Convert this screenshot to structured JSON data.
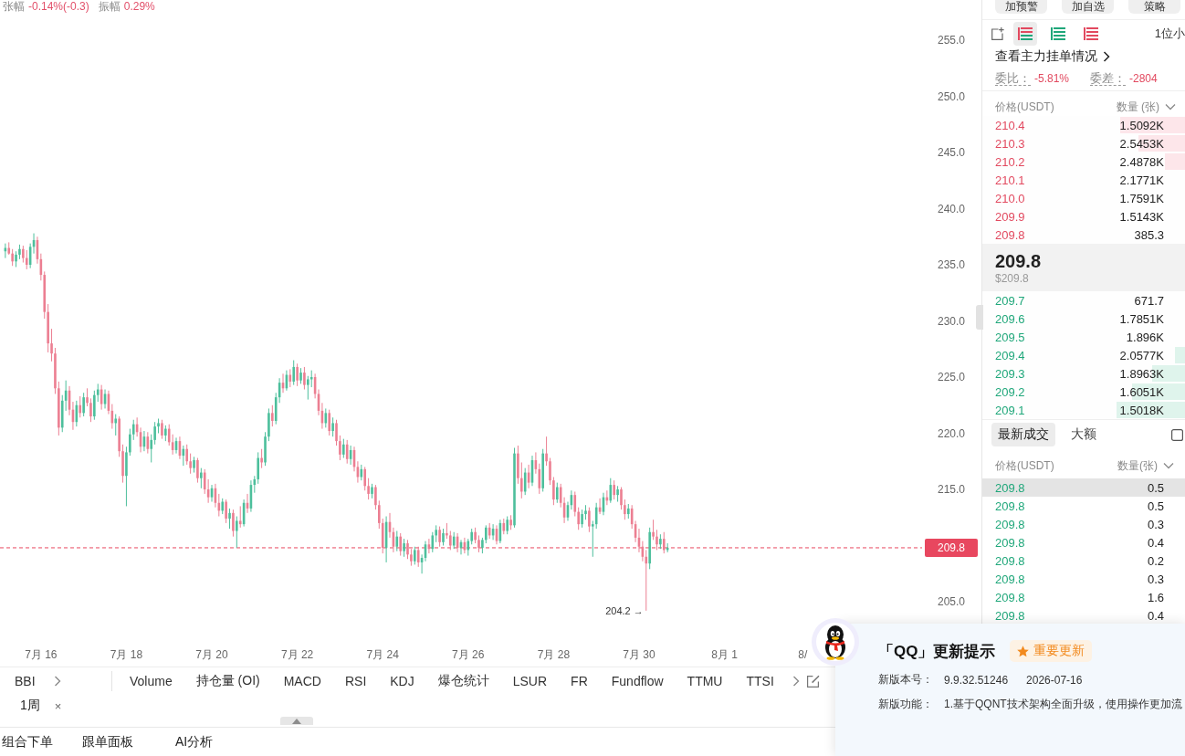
{
  "header": {
    "change_label": "张幅",
    "change_value": "-0.14%(-0.3)",
    "amplitude_label": "振幅",
    "amplitude_value": "0.29%"
  },
  "chart": {
    "chart_data": [
      {
        "type": "candlestick",
        "categories": [
          null,
          null,
          null,
          null,
          null,
          null,
          null,
          null,
          null,
          null,
          null,
          "7月 16",
          null,
          null,
          null,
          null,
          null,
          null,
          null,
          null,
          null,
          null,
          null,
          null,
          null,
          null,
          null,
          null,
          null,
          null,
          null,
          null,
          null,
          null,
          null,
          "7月 18",
          null,
          null,
          null,
          null,
          null,
          null,
          null,
          null,
          null,
          null,
          null,
          null,
          null,
          null,
          null,
          null,
          null,
          null,
          null,
          null,
          null,
          null,
          null,
          "7月 20",
          null,
          null,
          null,
          null,
          null,
          null,
          null,
          null,
          null,
          null,
          null,
          null,
          null,
          null,
          null,
          null,
          null,
          null,
          null,
          null,
          null,
          null,
          null,
          "7月 22",
          null,
          null,
          null,
          null,
          null,
          null,
          null,
          null,
          null,
          null,
          null,
          null,
          null,
          null,
          null,
          null,
          null,
          null,
          null,
          null,
          null,
          null,
          null,
          "7月 24",
          null,
          null,
          null,
          null,
          null,
          null,
          null,
          null,
          null,
          null,
          null,
          null,
          null,
          null,
          null,
          null,
          null,
          null,
          null,
          null,
          null,
          null,
          null,
          "7月 26",
          null,
          null,
          null,
          null,
          null,
          null,
          null,
          null,
          null,
          null,
          null,
          null,
          null,
          null,
          null,
          null,
          null,
          null,
          null,
          null,
          null,
          null,
          null,
          "7月 28",
          null,
          null,
          null,
          null,
          null,
          null,
          null,
          null,
          null,
          null,
          null,
          null,
          null,
          null,
          null,
          null,
          null,
          null,
          null,
          null,
          null,
          null,
          null,
          "7月 30",
          null,
          null,
          null,
          null,
          null,
          null,
          null,
          null,
          null,
          null,
          null,
          null,
          null,
          null,
          null,
          null,
          null,
          null,
          null,
          null,
          null,
          null,
          null,
          "8月 1",
          null,
          null,
          null,
          null,
          null,
          null,
          null,
          null,
          null,
          null,
          null,
          null,
          null,
          null,
          null,
          null,
          null,
          null,
          null,
          null,
          null,
          "8/",
          null,
          null,
          null,
          null,
          null,
          null,
          null,
          null,
          null,
          null,
          null,
          null,
          null,
          null,
          null,
          null,
          null,
          null,
          null,
          null,
          null,
          null,
          null,
          null,
          null,
          null,
          null,
          null,
          null,
          null,
          null,
          null,
          null
        ],
        "ylim": [
          205,
          255
        ],
        "yticks": [
          {
            "value": 205,
            "label": "205.0"
          },
          {
            "value": 215,
            "label": "215.0"
          },
          {
            "value": 220,
            "label": "220.0"
          },
          {
            "value": 225,
            "label": "225.0"
          },
          {
            "value": 230,
            "label": "230.0"
          },
          {
            "value": 235,
            "label": "235.0"
          },
          {
            "value": 240,
            "label": "240.0"
          },
          {
            "value": 245,
            "label": "245.0"
          },
          {
            "value": 250,
            "label": "250.0"
          },
          {
            "value": 255,
            "label": "255.0"
          }
        ],
        "ref_lines": [
          {
            "axis": "y",
            "value": 209.8,
            "label": "209.8",
            "color": "#e8475f",
            "line_style": "dashed"
          }
        ],
        "annotations": [
          "204.2 →"
        ],
        "ohlc": [
          null,
          [
            236.2,
            236.9,
            235.6,
            236.5
          ],
          [
            236.5,
            237.0,
            235.9,
            236.0
          ],
          [
            236.0,
            236.4,
            234.9,
            235.3
          ],
          [
            235.3,
            236.2,
            234.8,
            235.9
          ],
          [
            235.9,
            236.8,
            235.5,
            236.4
          ],
          [
            236.4,
            236.7,
            235.2,
            235.6
          ],
          [
            235.6,
            236.3,
            234.6,
            235.0
          ],
          [
            235.0,
            236.9,
            234.7,
            236.6
          ],
          [
            236.6,
            237.8,
            236.0,
            237.2
          ],
          [
            237.2,
            237.5,
            235.1,
            235.5
          ],
          [
            235.5,
            236.0,
            233.6,
            234.1
          ],
          [
            234.1,
            234.4,
            230.2,
            230.8
          ],
          [
            230.8,
            231.5,
            227.2,
            228.0
          ],
          [
            228.0,
            229.3,
            226.4,
            227.1
          ],
          [
            227.1,
            227.6,
            223.5,
            224.0
          ],
          [
            224.0,
            224.6,
            219.8,
            220.5
          ],
          [
            220.5,
            223.4,
            220.1,
            222.9
          ],
          [
            222.9,
            224.7,
            222.0,
            223.8
          ],
          [
            223.8,
            224.2,
            221.6,
            222.1
          ],
          [
            222.1,
            222.8,
            220.3,
            221.0
          ],
          [
            221.0,
            222.9,
            220.6,
            222.5
          ],
          [
            222.5,
            223.3,
            221.4,
            221.8
          ],
          [
            221.8,
            223.6,
            221.5,
            223.2
          ],
          [
            223.2,
            224.0,
            222.4,
            222.7
          ],
          [
            222.7,
            223.1,
            221.0,
            221.5
          ],
          [
            221.5,
            223.8,
            221.2,
            223.4
          ],
          [
            223.4,
            224.4,
            222.8,
            223.9
          ],
          [
            223.9,
            224.3,
            222.1,
            222.6
          ],
          [
            222.6,
            223.9,
            222.2,
            223.5
          ],
          [
            223.5,
            223.8,
            221.7,
            222.0
          ],
          [
            222.0,
            222.6,
            220.4,
            220.9
          ],
          [
            220.9,
            221.7,
            219.8,
            221.3
          ],
          [
            221.3,
            221.5,
            217.9,
            218.4
          ],
          [
            218.4,
            219.0,
            215.6,
            216.2
          ],
          [
            216.2,
            218.8,
            213.5,
            218.3
          ],
          [
            218.3,
            220.4,
            218.0,
            219.9
          ],
          [
            219.9,
            221.2,
            219.4,
            220.8
          ],
          [
            220.8,
            221.4,
            219.7,
            220.1
          ],
          [
            220.1,
            220.5,
            218.3,
            218.8
          ],
          [
            218.8,
            220.2,
            218.4,
            219.7
          ],
          [
            219.7,
            220.1,
            218.2,
            218.6
          ],
          [
            218.6,
            219.9,
            217.4,
            219.4
          ],
          [
            219.4,
            221.0,
            219.0,
            220.6
          ],
          [
            220.6,
            221.3,
            220.0,
            220.9
          ],
          [
            220.9,
            221.2,
            219.5,
            219.8
          ],
          [
            219.8,
            220.7,
            219.3,
            220.4
          ],
          [
            220.4,
            220.8,
            218.9,
            219.2
          ],
          [
            219.2,
            219.9,
            218.1,
            218.5
          ],
          [
            218.5,
            219.6,
            218.2,
            219.3
          ],
          [
            219.3,
            219.7,
            217.7,
            218.0
          ],
          [
            218.0,
            218.9,
            217.1,
            218.6
          ],
          [
            218.6,
            219.0,
            217.2,
            217.5
          ],
          [
            217.5,
            218.2,
            216.4,
            216.9
          ],
          [
            216.9,
            217.9,
            216.5,
            217.6
          ],
          [
            217.6,
            217.8,
            215.6,
            216.0
          ],
          [
            216.0,
            216.9,
            215.1,
            216.5
          ],
          [
            216.5,
            216.8,
            214.6,
            215.0
          ],
          [
            215.0,
            215.9,
            213.8,
            214.3
          ],
          [
            214.3,
            215.4,
            213.9,
            215.1
          ],
          [
            215.1,
            215.5,
            213.4,
            213.8
          ],
          [
            213.8,
            214.6,
            212.6,
            213.1
          ],
          [
            213.1,
            214.2,
            212.8,
            213.9
          ],
          [
            213.9,
            214.1,
            212.0,
            212.4
          ],
          [
            212.4,
            213.3,
            211.5,
            212.9
          ],
          [
            212.9,
            213.2,
            210.8,
            211.3
          ],
          [
            211.3,
            212.6,
            209.8,
            212.2
          ],
          [
            212.2,
            213.5,
            211.6,
            211.9
          ],
          [
            211.9,
            214.1,
            211.7,
            213.8
          ],
          [
            213.8,
            214.6,
            212.9,
            213.3
          ],
          [
            213.3,
            215.8,
            213.0,
            215.4
          ],
          [
            215.4,
            216.2,
            214.7,
            215.9
          ],
          [
            215.9,
            218.3,
            215.5,
            217.8
          ],
          [
            217.8,
            218.6,
            216.9,
            217.4
          ],
          [
            217.4,
            220.1,
            217.1,
            219.7
          ],
          [
            219.7,
            222.2,
            219.3,
            221.8
          ],
          [
            221.8,
            222.5,
            220.6,
            221.1
          ],
          [
            221.1,
            223.6,
            220.8,
            223.2
          ],
          [
            223.2,
            224.9,
            222.7,
            224.5
          ],
          [
            224.5,
            225.3,
            223.6,
            224.0
          ],
          [
            224.0,
            225.6,
            223.8,
            225.2
          ],
          [
            225.2,
            225.7,
            224.1,
            224.6
          ],
          [
            224.6,
            226.5,
            224.3,
            225.9
          ],
          [
            225.9,
            226.2,
            224.2,
            224.7
          ],
          [
            224.7,
            225.8,
            224.4,
            225.4
          ],
          [
            225.4,
            225.9,
            223.9,
            224.3
          ],
          [
            224.3,
            225.1,
            223.0,
            224.8
          ],
          [
            224.8,
            225.6,
            224.1,
            225.0
          ],
          [
            225.0,
            225.3,
            223.1,
            223.5
          ],
          [
            223.5,
            223.9,
            221.6,
            222.0
          ],
          [
            222.0,
            222.7,
            220.4,
            220.9
          ],
          [
            220.9,
            222.2,
            220.5,
            221.8
          ],
          [
            221.8,
            222.1,
            219.8,
            220.2
          ],
          [
            220.2,
            221.4,
            219.7,
            220.9
          ],
          [
            220.9,
            221.2,
            218.9,
            219.3
          ],
          [
            219.3,
            219.8,
            217.6,
            218.1
          ],
          [
            218.1,
            219.5,
            217.8,
            219.0
          ],
          [
            219.0,
            219.4,
            217.3,
            217.7
          ],
          [
            217.7,
            218.9,
            217.2,
            218.5
          ],
          [
            218.5,
            218.8,
            216.6,
            217.0
          ],
          [
            217.0,
            217.5,
            215.6,
            216.1
          ],
          [
            216.1,
            217.2,
            215.8,
            216.8
          ],
          [
            216.8,
            217.0,
            214.9,
            215.3
          ],
          [
            215.3,
            216.0,
            214.1,
            214.6
          ],
          [
            214.6,
            215.5,
            214.2,
            215.2
          ],
          [
            215.2,
            215.4,
            213.2,
            213.6
          ],
          [
            213.6,
            214.0,
            211.5,
            212.0
          ],
          [
            212.0,
            212.4,
            209.3,
            209.8
          ],
          [
            209.8,
            212.6,
            208.5,
            212.1
          ],
          [
            212.1,
            212.9,
            210.7,
            211.2
          ],
          [
            211.2,
            211.6,
            209.4,
            209.9
          ],
          [
            209.9,
            211.3,
            209.5,
            210.8
          ],
          [
            210.8,
            211.1,
            209.1,
            209.5
          ],
          [
            209.5,
            210.6,
            209.0,
            210.2
          ],
          [
            210.2,
            210.5,
            208.8,
            209.2
          ],
          [
            209.2,
            209.7,
            208.2,
            208.6
          ],
          [
            208.6,
            209.9,
            208.3,
            209.6
          ],
          [
            209.6,
            209.9,
            208.1,
            208.5
          ],
          [
            208.5,
            209.2,
            207.5,
            208.9
          ],
          [
            208.9,
            210.4,
            208.6,
            210.1
          ],
          [
            210.1,
            210.6,
            209.3,
            209.7
          ],
          [
            209.7,
            211.2,
            209.4,
            210.9
          ],
          [
            210.9,
            211.8,
            210.3,
            211.4
          ],
          [
            211.4,
            211.7,
            209.9,
            210.3
          ],
          [
            210.3,
            211.5,
            210.0,
            211.1
          ],
          [
            211.1,
            212.0,
            210.6,
            210.9
          ],
          [
            210.9,
            211.3,
            209.6,
            210.0
          ],
          [
            210.0,
            211.2,
            209.7,
            210.8
          ],
          [
            210.8,
            211.1,
            209.4,
            209.8
          ],
          [
            209.8,
            210.5,
            209.2,
            210.3
          ],
          [
            210.3,
            210.7,
            209.3,
            209.6
          ],
          [
            209.6,
            210.6,
            209.1,
            210.4
          ],
          [
            210.4,
            211.5,
            210.1,
            211.2
          ],
          [
            211.2,
            211.6,
            210.2,
            210.5
          ],
          [
            210.5,
            210.9,
            209.4,
            209.8
          ],
          [
            209.8,
            210.7,
            209.3,
            210.5
          ],
          [
            210.5,
            211.8,
            210.2,
            211.6
          ],
          [
            211.6,
            212.0,
            210.6,
            210.9
          ],
          [
            210.9,
            211.9,
            210.5,
            211.5
          ],
          [
            211.5,
            211.8,
            210.1,
            210.4
          ],
          [
            210.4,
            212.3,
            210.2,
            212.0
          ],
          [
            212.0,
            212.4,
            211.0,
            211.3
          ],
          [
            211.3,
            212.6,
            211.0,
            212.3
          ],
          [
            212.3,
            212.7,
            211.4,
            211.8
          ],
          [
            211.8,
            218.7,
            211.6,
            218.2
          ],
          [
            218.2,
            218.9,
            215.5,
            216.0
          ],
          [
            216.0,
            217.4,
            214.2,
            214.8
          ],
          [
            214.8,
            216.9,
            214.5,
            216.5
          ],
          [
            216.5,
            217.2,
            215.1,
            215.6
          ],
          [
            215.6,
            218.0,
            215.3,
            217.6
          ],
          [
            217.6,
            218.3,
            216.4,
            216.8
          ],
          [
            216.8,
            217.3,
            214.6,
            215.1
          ],
          [
            215.1,
            218.6,
            214.8,
            218.2
          ],
          [
            218.2,
            219.7,
            217.1,
            217.5
          ],
          [
            217.5,
            217.8,
            215.4,
            215.8
          ],
          [
            215.8,
            216.1,
            213.6,
            214.1
          ],
          [
            214.1,
            215.6,
            213.8,
            215.2
          ],
          [
            215.2,
            215.5,
            213.4,
            213.8
          ],
          [
            213.8,
            214.3,
            212.0,
            212.5
          ],
          [
            212.5,
            213.9,
            212.2,
            213.6
          ],
          [
            213.6,
            214.9,
            213.2,
            214.5
          ],
          [
            214.5,
            214.8,
            212.6,
            213.0
          ],
          [
            213.0,
            213.4,
            211.4,
            211.9
          ],
          [
            211.9,
            213.2,
            211.6,
            212.8
          ],
          [
            212.8,
            213.6,
            212.3,
            213.1
          ],
          [
            213.1,
            213.4,
            211.2,
            211.7
          ],
          [
            211.7,
            212.2,
            209.0,
            211.9
          ],
          [
            211.9,
            213.8,
            211.5,
            213.4
          ],
          [
            213.4,
            214.2,
            212.8,
            213.0
          ],
          [
            213.0,
            214.7,
            212.7,
            214.3
          ],
          [
            214.3,
            214.9,
            213.6,
            214.0
          ],
          [
            214.0,
            216.0,
            213.8,
            215.4
          ],
          [
            215.4,
            215.8,
            214.1,
            214.5
          ],
          [
            214.5,
            215.3,
            213.9,
            215.0
          ],
          [
            215.0,
            215.2,
            213.2,
            213.6
          ],
          [
            213.6,
            214.1,
            212.3,
            212.8
          ],
          [
            212.8,
            213.7,
            212.4,
            213.3
          ],
          [
            213.3,
            213.6,
            211.5,
            211.9
          ],
          [
            211.9,
            212.2,
            210.3,
            210.7
          ],
          [
            210.7,
            211.5,
            209.4,
            209.9
          ],
          [
            209.9,
            210.4,
            208.6,
            209.0
          ],
          [
            209.0,
            209.6,
            204.2,
            208.4
          ],
          [
            208.4,
            211.6,
            207.9,
            211.2
          ],
          [
            211.2,
            212.3,
            210.5,
            210.8
          ],
          [
            210.8,
            211.4,
            209.6,
            210.1
          ],
          [
            210.1,
            211.0,
            209.7,
            210.6
          ],
          [
            210.6,
            211.2,
            209.3,
            209.6
          ],
          [
            209.6,
            210.2,
            209.4,
            209.8
          ],
          null,
          null,
          null,
          null,
          null,
          null,
          null,
          null,
          null,
          null,
          null,
          null,
          null,
          null,
          null,
          null,
          null,
          null,
          null,
          null,
          null,
          null,
          null,
          null,
          null,
          null,
          null,
          null,
          null,
          null,
          null,
          null,
          null,
          null,
          null,
          null,
          null,
          null,
          null,
          null,
          null,
          null,
          null,
          null,
          null,
          null,
          null,
          null,
          null,
          null,
          null,
          null,
          null,
          null,
          null,
          null,
          null,
          null,
          null,
          null,
          null,
          null,
          null,
          null,
          null,
          null,
          null,
          null,
          null,
          null,
          null
        ]
      }
    ]
  },
  "indicator_bar": {
    "main": "BBI",
    "items": [
      "Volume",
      "持仓量 (OI)",
      "MACD",
      "RSI",
      "KDJ",
      "爆仓统计",
      "LSUR",
      "FR",
      "Fundflow",
      "TTMU",
      "TTSI"
    ]
  },
  "interval_tabs": [
    {
      "label": "1周",
      "close": "×"
    }
  ],
  "bottom_tabs": [
    "组合下单",
    "跟单面板",
    "AI分析"
  ],
  "order_panel": {
    "actions": [
      "加预警",
      "加自选",
      "策略"
    ],
    "view_modes": [
      {
        "kind": "both",
        "selected": true
      },
      {
        "kind": "bids",
        "selected": false
      },
      {
        "kind": "asks",
        "selected": false
      }
    ],
    "precision": "1位小",
    "depth_link": "查看主力挂单情况",
    "stats": [
      {
        "label": "委比：",
        "value": "-5.81%"
      },
      {
        "label": "委差：",
        "value": "-2804"
      }
    ],
    "book_columns": [
      "价格(USDT)",
      "数量 (张)"
    ],
    "asks": [
      {
        "price": "210.4",
        "qty": "1.5092K",
        "level": 0.32
      },
      {
        "price": "210.3",
        "qty": "2.5453K",
        "level": 0.23
      },
      {
        "price": "210.2",
        "qty": "2.4878K",
        "level": 0.1
      },
      {
        "price": "210.1",
        "qty": "2.1771K"
      },
      {
        "price": "210.0",
        "qty": "1.7591K"
      },
      {
        "price": "209.9",
        "qty": "1.5143K"
      },
      {
        "price": "209.8",
        "qty": "385.3"
      }
    ],
    "last_price": "209.8",
    "last_price_usd": "$209.8",
    "bids": [
      {
        "price": "209.7",
        "qty": "671.7"
      },
      {
        "price": "209.6",
        "qty": "1.7851K"
      },
      {
        "price": "209.5",
        "qty": "1.896K"
      },
      {
        "price": "209.4",
        "qty": "2.0577K",
        "level": 0.05
      },
      {
        "price": "209.3",
        "qty": "1.8963K",
        "level": 0.16
      },
      {
        "price": "209.2",
        "qty": "1.6051K",
        "level": 0.26
      },
      {
        "price": "209.1",
        "qty": "1.5018K",
        "level": 0.34
      }
    ],
    "trade_tabs": [
      {
        "label": "最新成交",
        "selected": true
      },
      {
        "label": "大额",
        "selected": false
      }
    ],
    "large_filter": {
      "checked": false
    },
    "trade_columns": [
      "价格(USDT)",
      "数量(张)"
    ],
    "trades": [
      {
        "price": "209.8",
        "qty": "0.5",
        "kind": "buy",
        "highlighted": true
      },
      {
        "price": "209.8",
        "qty": "0.5",
        "kind": "buy",
        "highlighted": false
      },
      {
        "price": "209.8",
        "qty": "0.3",
        "kind": "buy",
        "highlighted": false
      },
      {
        "price": "209.8",
        "qty": "0.4",
        "kind": "buy",
        "highlighted": false
      },
      {
        "price": "209.8",
        "qty": "0.2",
        "kind": "buy",
        "highlighted": false
      },
      {
        "price": "209.8",
        "qty": "0.3",
        "kind": "buy",
        "highlighted": false
      },
      {
        "price": "209.8",
        "qty": "1.6",
        "kind": "buy",
        "highlighted": false
      },
      {
        "price": "209.8",
        "qty": "0.4",
        "kind": "buy",
        "highlighted": false
      }
    ]
  },
  "update_popup": {
    "title": "「QQ」更新提示",
    "badge": "重要更新",
    "fields": [
      {
        "label": "新版本号：",
        "values": [
          "9.9.32.51246",
          "2026-07-16"
        ]
      },
      {
        "label": "新版功能：",
        "values": [
          "1.基于QQNT技术架构全面升级，使用操作更加流"
        ]
      }
    ]
  }
}
